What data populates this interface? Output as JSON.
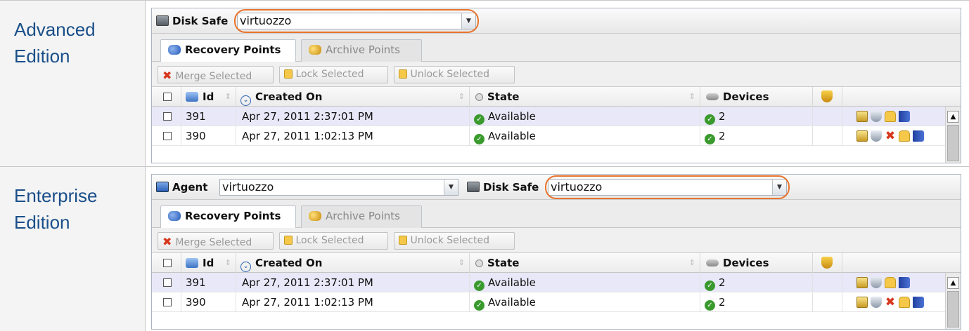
{
  "editions": [
    {
      "label_line1": "Advanced",
      "label_line2": "Edition",
      "disk_safe_label": "Disk Safe",
      "disk_safe_value": "virtuozzo",
      "tabs": [
        "Recovery Points",
        "Archive Points"
      ],
      "toolbar": [
        "Merge Selected",
        "Lock Selected",
        "Unlock Selected"
      ],
      "columns": {
        "id": "Id",
        "created": "Created On",
        "state": "State",
        "devices": "Devices"
      },
      "rows": [
        {
          "id": "391",
          "created": "Apr 27, 2011 2:37:01 PM",
          "state": "Available",
          "devices": "2"
        },
        {
          "id": "390",
          "created": "Apr 27, 2011 1:02:13 PM",
          "state": "Available",
          "devices": "2"
        }
      ]
    },
    {
      "label_line1": "Enterprise",
      "label_line2": "Edition",
      "agent_label": "Agent",
      "agent_value": "virtuozzo",
      "disk_safe_label": "Disk Safe",
      "disk_safe_value": "virtuozzo",
      "tabs": [
        "Recovery Points",
        "Archive Points"
      ],
      "toolbar": [
        "Merge Selected",
        "Lock Selected",
        "Unlock Selected"
      ],
      "columns": {
        "id": "Id",
        "created": "Created On",
        "state": "State",
        "devices": "Devices"
      },
      "rows": [
        {
          "id": "391",
          "created": "Apr 27, 2011 2:37:01 PM",
          "state": "Available",
          "devices": "2"
        },
        {
          "id": "390",
          "created": "Apr 27, 2011 1:02:13 PM",
          "state": "Available",
          "devices": "2"
        }
      ]
    }
  ],
  "colors": {
    "highlight_ring": "#e8742c",
    "label_text": "#1a4f8a",
    "selected_row": "#e8e8f8",
    "ok_green": "#3a9a2d",
    "delete_red": "#d7371d"
  },
  "icons": [
    "disk-safe-icon",
    "agent-icon",
    "recovery-points-icon",
    "archive-points-icon",
    "merge-icon",
    "lock-icon",
    "unlock-icon",
    "properties-icon",
    "shield-icon",
    "delete-icon",
    "book-icon"
  ]
}
